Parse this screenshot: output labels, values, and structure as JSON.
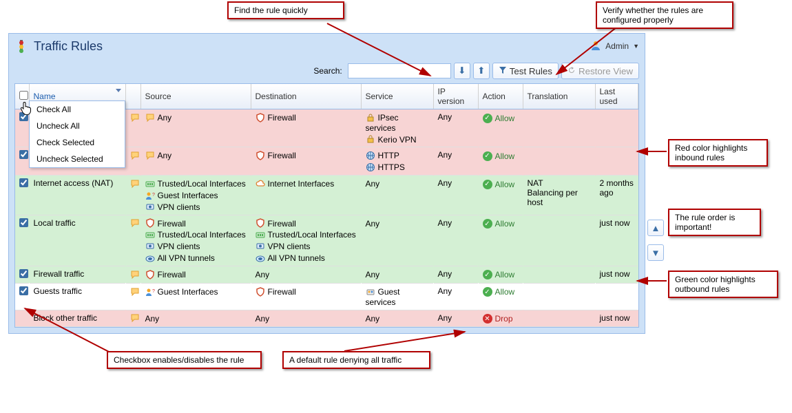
{
  "title": "Traffic Rules",
  "user_menu": {
    "label": "Admin"
  },
  "toolbar": {
    "search_label": "Search:",
    "search_placeholder": "",
    "test_rules": "Test Rules",
    "restore_view": "Restore View"
  },
  "columns": {
    "checkbox": "",
    "name": "Name",
    "comment": "",
    "source": "Source",
    "destination": "Destination",
    "service": "Service",
    "ip_version": "IP version",
    "action": "Action",
    "translation": "Translation",
    "last_used": "Last used"
  },
  "header_menu": {
    "check_all": "Check All",
    "uncheck_all": "Uncheck All",
    "check_selected": "Check Selected",
    "uncheck_selected": "Uncheck Selected"
  },
  "rows": [
    {
      "color": "red",
      "checked": true,
      "name": "",
      "source": [
        {
          "icon": "chat",
          "text": "Any"
        }
      ],
      "destination": [
        {
          "icon": "shield",
          "text": "Firewall"
        }
      ],
      "service": [
        {
          "icon": "lock",
          "text": "IPsec services"
        },
        {
          "icon": "lock",
          "text": "Kerio VPN"
        }
      ],
      "ip_version": "Any",
      "action": "Allow",
      "translation": "",
      "last_used": ""
    },
    {
      "color": "red",
      "checked": true,
      "name": "",
      "source": [
        {
          "icon": "chat",
          "text": "Any"
        }
      ],
      "destination": [
        {
          "icon": "shield",
          "text": "Firewall"
        }
      ],
      "service": [
        {
          "icon": "globe",
          "text": "HTTP"
        },
        {
          "icon": "globe",
          "text": "HTTPS"
        }
      ],
      "ip_version": "Any",
      "action": "Allow",
      "translation": "",
      "last_used": ""
    },
    {
      "color": "green",
      "checked": true,
      "name": "Internet access (NAT)",
      "source": [
        {
          "icon": "iface",
          "text": "Trusted/Local Interfaces"
        },
        {
          "icon": "guest",
          "text": "Guest Interfaces"
        },
        {
          "icon": "vpn",
          "text": "VPN clients"
        }
      ],
      "destination": [
        {
          "icon": "cloud",
          "text": "Internet Interfaces"
        }
      ],
      "service": [
        {
          "icon": "",
          "text": "Any"
        }
      ],
      "ip_version": "Any",
      "action": "Allow",
      "translation": "NAT\nBalancing per host",
      "last_used": "2 months ago"
    },
    {
      "color": "green",
      "checked": true,
      "name": "Local traffic",
      "source": [
        {
          "icon": "shield",
          "text": "Firewall"
        },
        {
          "icon": "iface",
          "text": "Trusted/Local Interfaces"
        },
        {
          "icon": "vpn",
          "text": "VPN clients"
        },
        {
          "icon": "tunnel",
          "text": "All VPN tunnels"
        }
      ],
      "destination": [
        {
          "icon": "shield",
          "text": "Firewall"
        },
        {
          "icon": "iface",
          "text": "Trusted/Local Interfaces"
        },
        {
          "icon": "vpn",
          "text": "VPN clients"
        },
        {
          "icon": "tunnel",
          "text": "All VPN tunnels"
        }
      ],
      "service": [
        {
          "icon": "",
          "text": "Any"
        }
      ],
      "ip_version": "Any",
      "action": "Allow",
      "translation": "",
      "last_used": "just now"
    },
    {
      "color": "green",
      "checked": true,
      "name": "Firewall traffic",
      "source": [
        {
          "icon": "shield",
          "text": "Firewall"
        }
      ],
      "destination": [
        {
          "icon": "",
          "text": "Any"
        }
      ],
      "service": [
        {
          "icon": "",
          "text": "Any"
        }
      ],
      "ip_version": "Any",
      "action": "Allow",
      "translation": "",
      "last_used": "just now"
    },
    {
      "color": "white",
      "checked": true,
      "name": "Guests traffic",
      "source": [
        {
          "icon": "guest",
          "text": "Guest Interfaces"
        }
      ],
      "destination": [
        {
          "icon": "shield",
          "text": "Firewall"
        }
      ],
      "service": [
        {
          "icon": "guestsvc",
          "text": "Guest services"
        }
      ],
      "ip_version": "Any",
      "action": "Allow",
      "translation": "",
      "last_used": ""
    },
    {
      "color": "red",
      "checked": false,
      "name": "Block other traffic",
      "nocheckbox": true,
      "source": [
        {
          "icon": "",
          "text": "Any"
        }
      ],
      "destination": [
        {
          "icon": "",
          "text": "Any"
        }
      ],
      "service": [
        {
          "icon": "",
          "text": "Any"
        }
      ],
      "ip_version": "Any",
      "action": "Drop",
      "translation": "",
      "last_used": "just now"
    }
  ],
  "callouts": {
    "find_rule": "Find the rule quickly",
    "verify_rules": "Verify whether the rules are configured properly",
    "red_rows": "Red color highlights inbound rules",
    "rule_order": "The rule order is important!",
    "green_rows": "Green color highlights outbound rules",
    "checkbox_enable": "Checkbox enables/disables the rule",
    "default_deny": "A default rule denying all traffic"
  }
}
